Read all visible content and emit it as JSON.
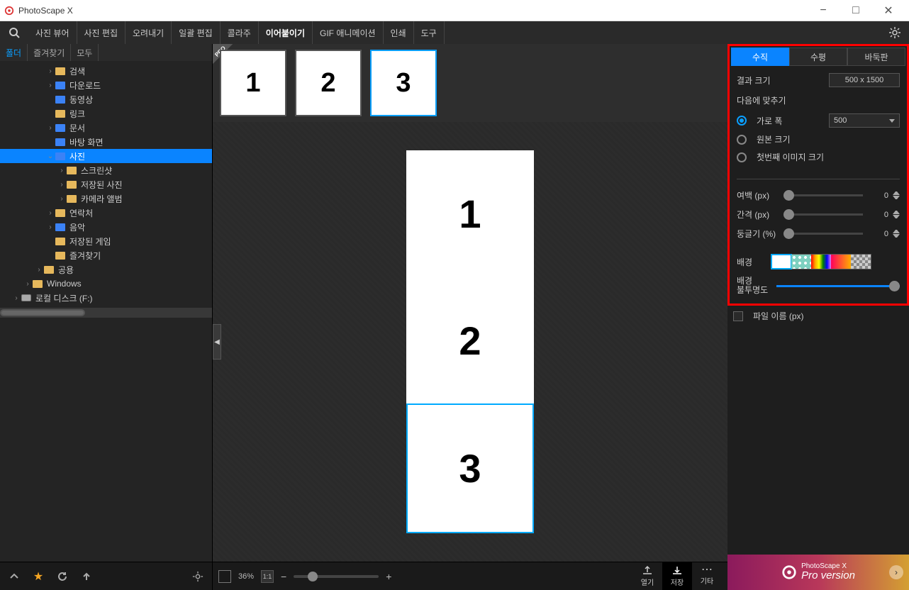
{
  "app": {
    "title": "PhotoScape X"
  },
  "winbtns": {
    "min": "−",
    "max": "□",
    "close": "✕"
  },
  "toolbar": {
    "tabs": [
      "사진 뷰어",
      "사진 편집",
      "오려내기",
      "일괄 편집",
      "콜라주",
      "이어붙이기",
      "GIF 애니메이션",
      "인쇄",
      "도구"
    ],
    "active_index": 5
  },
  "sidebar_left": {
    "tabs": [
      "폴더",
      "즐겨찾기",
      "모두"
    ],
    "active_index": 0,
    "tree": [
      {
        "depth": 4,
        "chev": ">",
        "icon": "folder",
        "color": "yellow",
        "label": "검색"
      },
      {
        "depth": 4,
        "chev": ">",
        "icon": "download",
        "color": "blue",
        "label": "다운로드"
      },
      {
        "depth": 4,
        "chev": "",
        "icon": "video",
        "color": "blue",
        "label": "동영상"
      },
      {
        "depth": 4,
        "chev": "",
        "icon": "folder",
        "color": "yellow",
        "label": "링크"
      },
      {
        "depth": 4,
        "chev": ">",
        "icon": "doc",
        "color": "blue",
        "label": "문서"
      },
      {
        "depth": 4,
        "chev": "",
        "icon": "folder",
        "color": "blue",
        "label": "바탕 화면"
      },
      {
        "depth": 4,
        "chev": "v",
        "icon": "folder-open",
        "color": "blue",
        "label": "사진",
        "selected": true
      },
      {
        "depth": 5,
        "chev": ">",
        "icon": "folder",
        "color": "yellow",
        "label": "스크린샷"
      },
      {
        "depth": 5,
        "chev": ">",
        "icon": "folder",
        "color": "yellow",
        "label": "저장된 사진"
      },
      {
        "depth": 5,
        "chev": ">",
        "icon": "folder",
        "color": "yellow",
        "label": "카메라 앨범"
      },
      {
        "depth": 4,
        "chev": ">",
        "icon": "folder",
        "color": "yellow",
        "label": "연락처"
      },
      {
        "depth": 4,
        "chev": ">",
        "icon": "music",
        "color": "blue",
        "label": "음악"
      },
      {
        "depth": 4,
        "chev": "",
        "icon": "folder",
        "color": "yellow",
        "label": "저장된 게임"
      },
      {
        "depth": 4,
        "chev": "",
        "icon": "folder",
        "color": "yellow",
        "label": "즐겨찾기"
      },
      {
        "depth": 3,
        "chev": ">",
        "icon": "folder",
        "color": "yellow",
        "label": "공용"
      },
      {
        "depth": 2,
        "chev": ">",
        "icon": "folder",
        "color": "yellow",
        "label": "Windows"
      },
      {
        "depth": 1,
        "chev": ">",
        "icon": "hdd",
        "color": "gray",
        "label": "로컬 디스크 (F:)"
      }
    ]
  },
  "thumbs": {
    "pro_label": "PRO",
    "items": [
      {
        "label": "1"
      },
      {
        "label": "2"
      },
      {
        "label": "3",
        "active": true
      }
    ]
  },
  "canvas": {
    "cells": [
      {
        "label": "1"
      },
      {
        "label": "2"
      },
      {
        "label": "3",
        "selected": true
      }
    ]
  },
  "canvas_footer": {
    "zoom_pct": "36%",
    "fit_label": "1:1",
    "minus": "−",
    "plus": "+",
    "open": "열기",
    "save": "저장",
    "other": "기타"
  },
  "right": {
    "orient_tabs": [
      "수직",
      "수평",
      "바둑판"
    ],
    "orient_active": 0,
    "result_size_label": "결과 크기",
    "result_size_value": "500 x 1500",
    "fit_label": "다음에 맞추기",
    "radios": [
      {
        "label": "가로 폭",
        "on": true,
        "select": "500"
      },
      {
        "label": "원본 크기",
        "on": false
      },
      {
        "label": "첫번째 이미지 크기",
        "on": false
      }
    ],
    "sliders": [
      {
        "label": "여백 (px)",
        "value": "0"
      },
      {
        "label": "간격 (px)",
        "value": "0"
      },
      {
        "label": "둥글기 (%)",
        "value": "0"
      }
    ],
    "bg_label": "배경",
    "bg_opacity_label_1": "배경",
    "bg_opacity_label_2": "불투명도",
    "filename_label": "파일 이름 (px)"
  },
  "pro_banner": {
    "brand": "PhotoScape X",
    "text": "Pro version"
  }
}
